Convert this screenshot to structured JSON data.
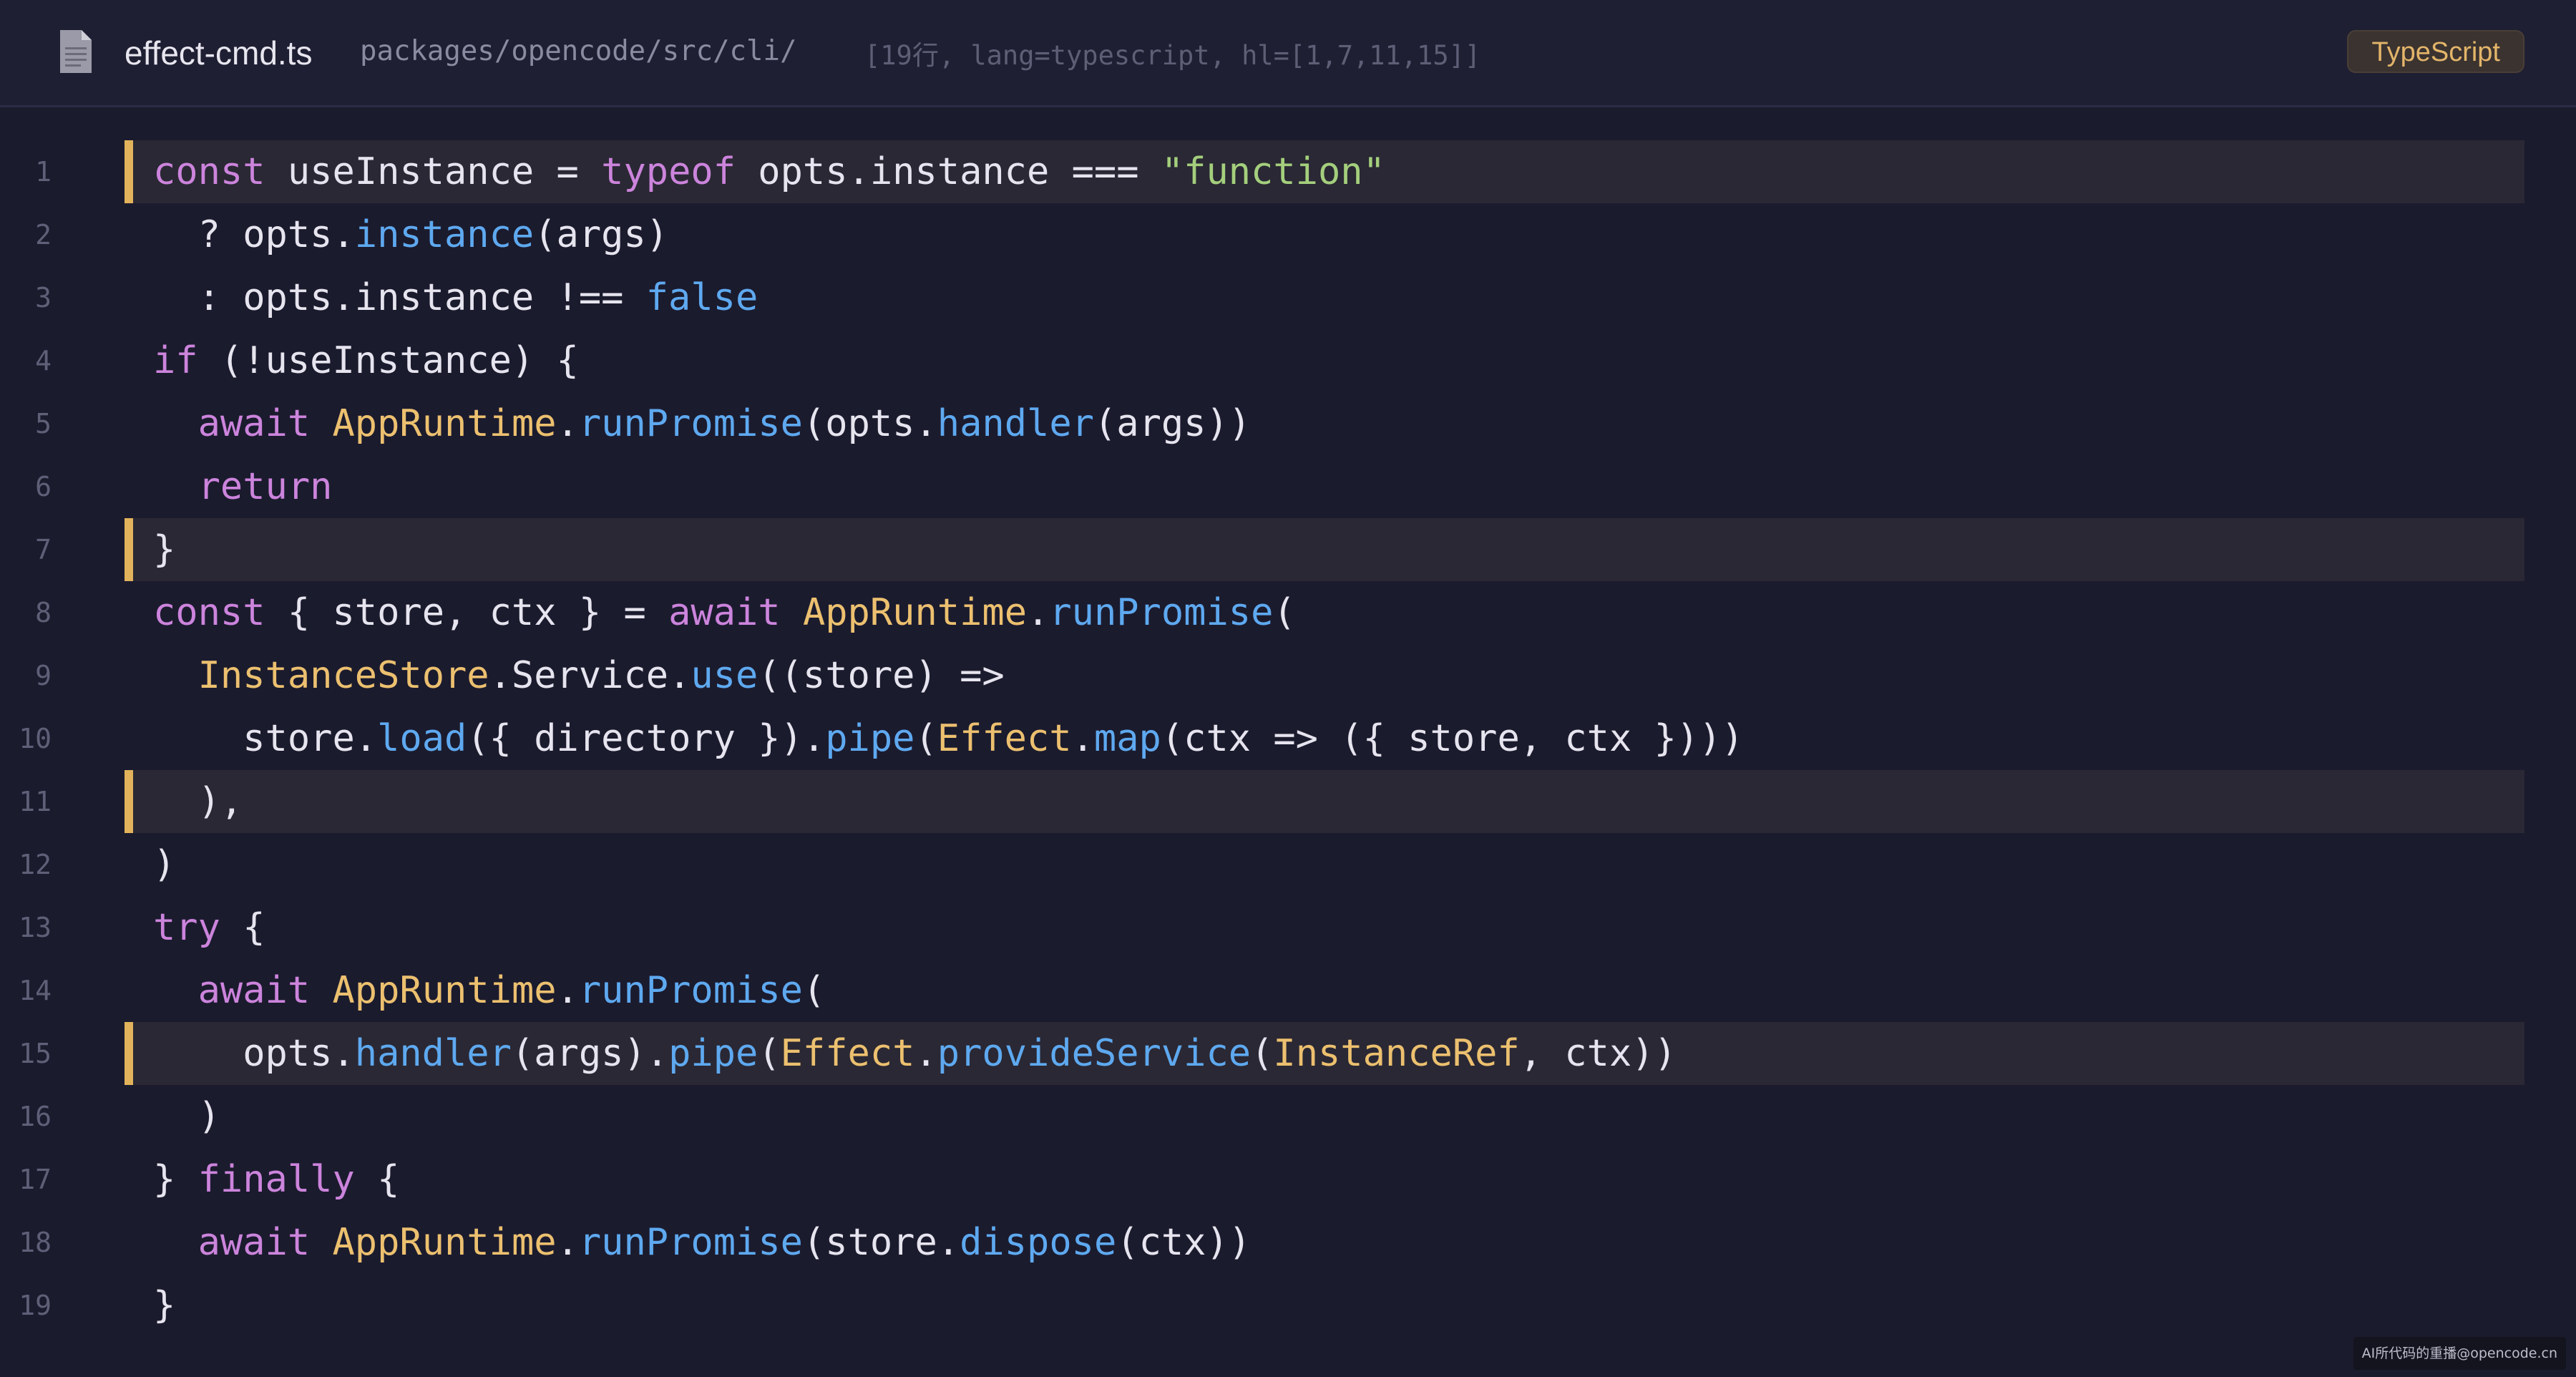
{
  "header": {
    "file_name": "effect-cmd.ts",
    "file_path": "packages/opencode/src/cli/",
    "meta": "[19行, lang=typescript, hl=[1,7,11,15]]",
    "language_badge": "TypeScript",
    "file_icon": "document-icon"
  },
  "colors": {
    "background": "#1b1b2e",
    "keyword": "#cc84dc",
    "type": "#ecc06f",
    "function": "#5ea9f0",
    "string": "#a4cf7d",
    "highlight_bar": "#e2b35b"
  },
  "highlighted_lines": [
    1,
    7,
    11,
    15
  ],
  "lines": [
    {
      "n": "1",
      "tokens": [
        [
          "kw",
          "const"
        ],
        [
          "pl",
          " useInstance = "
        ],
        [
          "kw",
          "typeof"
        ],
        [
          "pl",
          " opts.instance === "
        ],
        [
          "str",
          "\"function\""
        ]
      ]
    },
    {
      "n": "2",
      "tokens": [
        [
          "pl",
          "  ? opts."
        ],
        [
          "fn",
          "instance"
        ],
        [
          "pl",
          "(args)"
        ]
      ]
    },
    {
      "n": "3",
      "tokens": [
        [
          "pl",
          "  : opts.instance !== "
        ],
        [
          "bool",
          "false"
        ]
      ]
    },
    {
      "n": "4",
      "tokens": [
        [
          "kw",
          "if"
        ],
        [
          "pl",
          " (!useInstance) {"
        ]
      ]
    },
    {
      "n": "5",
      "tokens": [
        [
          "pl",
          "  "
        ],
        [
          "kw",
          "await"
        ],
        [
          "pl",
          " "
        ],
        [
          "ty",
          "AppRuntime"
        ],
        [
          "pl",
          "."
        ],
        [
          "fn",
          "runPromise"
        ],
        [
          "pl",
          "(opts."
        ],
        [
          "fn",
          "handler"
        ],
        [
          "pl",
          "(args))"
        ]
      ]
    },
    {
      "n": "6",
      "tokens": [
        [
          "pl",
          "  "
        ],
        [
          "kw",
          "return"
        ]
      ]
    },
    {
      "n": "7",
      "tokens": [
        [
          "pl",
          "}"
        ]
      ]
    },
    {
      "n": "8",
      "tokens": [
        [
          "kw",
          "const"
        ],
        [
          "pl",
          " { store, ctx } = "
        ],
        [
          "kw",
          "await"
        ],
        [
          "pl",
          " "
        ],
        [
          "ty",
          "AppRuntime"
        ],
        [
          "pl",
          "."
        ],
        [
          "fn",
          "runPromise"
        ],
        [
          "pl",
          "("
        ]
      ]
    },
    {
      "n": "9",
      "tokens": [
        [
          "pl",
          "  "
        ],
        [
          "ty",
          "InstanceStore"
        ],
        [
          "pl",
          ".Service."
        ],
        [
          "fn",
          "use"
        ],
        [
          "pl",
          "((store) =>"
        ]
      ]
    },
    {
      "n": "10",
      "tokens": [
        [
          "pl",
          "    store."
        ],
        [
          "fn",
          "load"
        ],
        [
          "pl",
          "({ directory })."
        ],
        [
          "fn",
          "pipe"
        ],
        [
          "pl",
          "("
        ],
        [
          "ty",
          "Effect"
        ],
        [
          "pl",
          "."
        ],
        [
          "fn",
          "map"
        ],
        [
          "pl",
          "(ctx => ({ store, ctx })))"
        ]
      ]
    },
    {
      "n": "11",
      "tokens": [
        [
          "pl",
          "  ),"
        ]
      ]
    },
    {
      "n": "12",
      "tokens": [
        [
          "pl",
          ")"
        ]
      ]
    },
    {
      "n": "13",
      "tokens": [
        [
          "kw",
          "try"
        ],
        [
          "pl",
          " {"
        ]
      ]
    },
    {
      "n": "14",
      "tokens": [
        [
          "pl",
          "  "
        ],
        [
          "kw",
          "await"
        ],
        [
          "pl",
          " "
        ],
        [
          "ty",
          "AppRuntime"
        ],
        [
          "pl",
          "."
        ],
        [
          "fn",
          "runPromise"
        ],
        [
          "pl",
          "("
        ]
      ]
    },
    {
      "n": "15",
      "tokens": [
        [
          "pl",
          "    opts."
        ],
        [
          "fn",
          "handler"
        ],
        [
          "pl",
          "(args)."
        ],
        [
          "fn",
          "pipe"
        ],
        [
          "pl",
          "("
        ],
        [
          "ty",
          "Effect"
        ],
        [
          "pl",
          "."
        ],
        [
          "fn",
          "provideService"
        ],
        [
          "pl",
          "("
        ],
        [
          "ty",
          "InstanceRef"
        ],
        [
          "pl",
          ", ctx))"
        ]
      ]
    },
    {
      "n": "16",
      "tokens": [
        [
          "pl",
          "  )"
        ]
      ]
    },
    {
      "n": "17",
      "tokens": [
        [
          "pl",
          "} "
        ],
        [
          "kw",
          "finally"
        ],
        [
          "pl",
          " {"
        ]
      ]
    },
    {
      "n": "18",
      "tokens": [
        [
          "pl",
          "  "
        ],
        [
          "kw",
          "await"
        ],
        [
          "pl",
          " "
        ],
        [
          "ty",
          "AppRuntime"
        ],
        [
          "pl",
          "."
        ],
        [
          "fn",
          "runPromise"
        ],
        [
          "pl",
          "(store."
        ],
        [
          "fn",
          "dispose"
        ],
        [
          "pl",
          "(ctx))"
        ]
      ]
    },
    {
      "n": "19",
      "tokens": [
        [
          "pl",
          "}"
        ]
      ]
    }
  ],
  "watermark": "AI所代码的重播@opencode.cn"
}
